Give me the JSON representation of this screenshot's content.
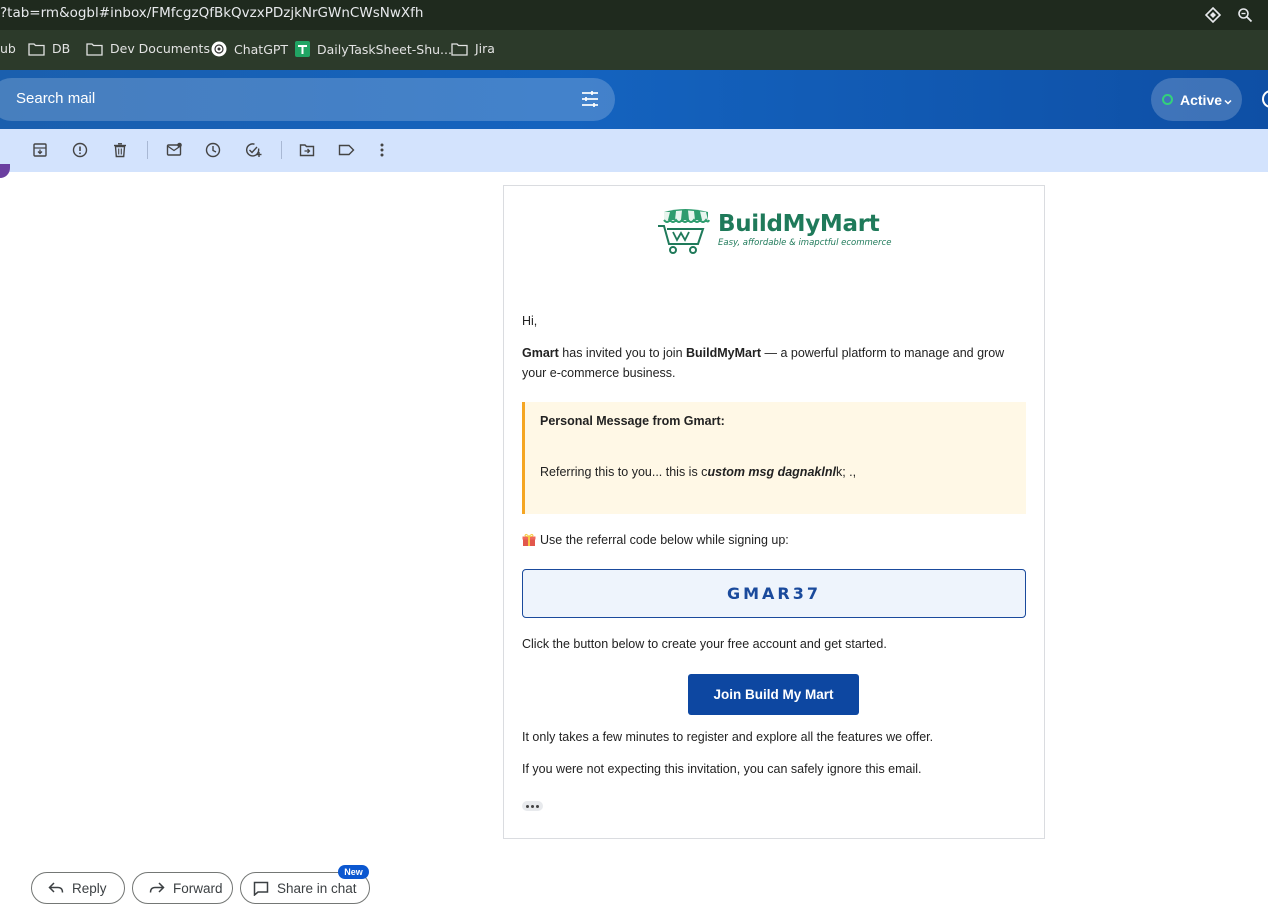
{
  "browser": {
    "url": "?tab=rm&ogbl#inbox/FMfcgzQfBkQvzxPDzjkNrGWnCWsNwXfh",
    "bookmarks": [
      {
        "label": "ub",
        "icon": "folder-icon"
      },
      {
        "label": "DB",
        "icon": "folder-icon"
      },
      {
        "label": "Dev Documents",
        "icon": "folder-icon"
      },
      {
        "label": "ChatGPT",
        "icon": "chatgpt-icon"
      },
      {
        "label": "DailyTaskSheet-Shu...",
        "icon": "sheets-icon"
      },
      {
        "label": "Jira",
        "icon": "folder-icon"
      }
    ]
  },
  "gmail": {
    "search_placeholder": "Search mail",
    "status": "Active",
    "status_color": "#33d17a",
    "toolbar_icons": [
      "archive-icon",
      "report-spam-icon",
      "delete-icon",
      "mark-unread-icon",
      "snooze-icon",
      "add-task-icon",
      "move-to-icon",
      "label-icon",
      "more-icon"
    ]
  },
  "email": {
    "brand_name": "BuildMyMart",
    "brand_tagline": "Easy, affordable & imapctful ecommerce",
    "brand_color": "#1f7a5a",
    "greeting": "Hi,",
    "inviter": "Gmart",
    "invite_mid": " has invited you to join ",
    "platform": "BuildMyMart",
    "invite_tail": " — a powerful platform to manage and grow your e-commerce business.",
    "personal_title": "Personal Message from Gmart:",
    "personal_msg_pre": "Referring this to you... this is c",
    "personal_msg_em": "ustom msg dagnaklnl",
    "personal_msg_post": "k; .,",
    "referral_prompt": "Use the referral code below while signing up:",
    "referral_code": "GMAR37",
    "click_text": "Click the button below to create your free account and get started.",
    "cta_label": "Join Build My Mart",
    "cta_color": "#0d47a1",
    "few_minutes": "It only takes a few minutes to register and explore all the features we offer.",
    "ignore_text": "If you were not expecting this invitation, you can safely ignore this email."
  },
  "actions": {
    "reply": "Reply",
    "forward": "Forward",
    "share": "Share in chat",
    "new_badge": "New"
  }
}
